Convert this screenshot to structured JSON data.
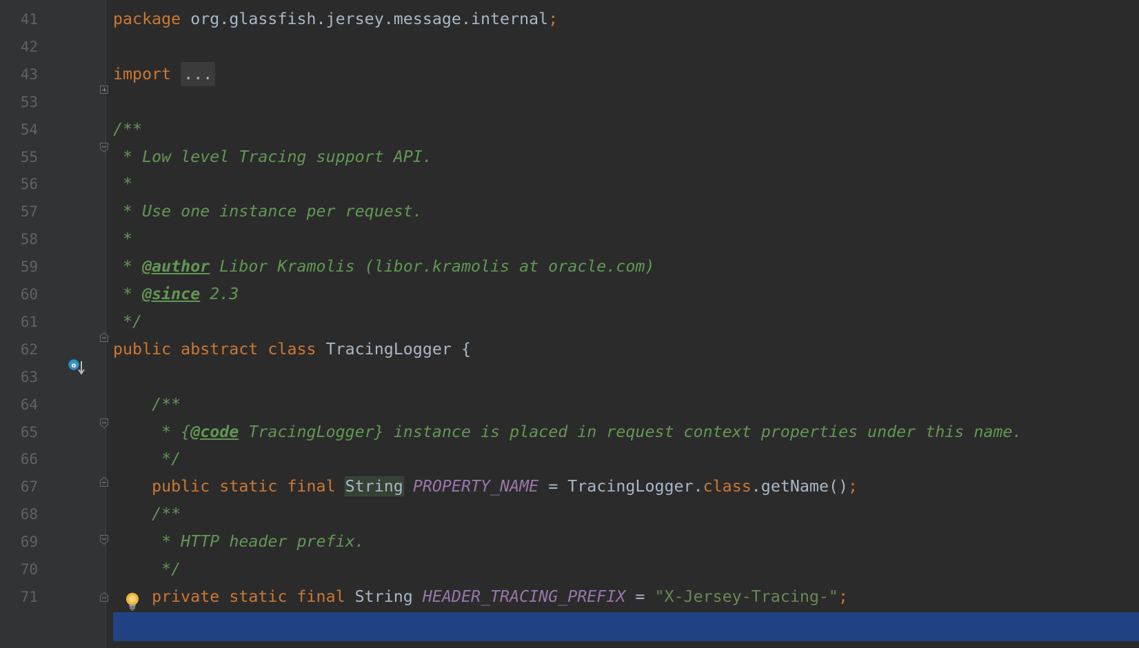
{
  "editor": {
    "lines": [
      {
        "n": "41",
        "segs": [
          [
            "kw",
            "package "
          ],
          [
            "pl",
            "org.glassfish.jersey.message.internal"
          ],
          [
            "kw",
            ";"
          ]
        ]
      },
      {
        "n": "42",
        "segs": []
      },
      {
        "n": "43",
        "segs": [
          [
            "kw",
            "import "
          ],
          [
            "fold",
            "..."
          ]
        ]
      },
      {
        "n": "53",
        "segs": []
      },
      {
        "n": "54",
        "segs": [
          [
            "cm",
            "/**"
          ]
        ]
      },
      {
        "n": "55",
        "segs": [
          [
            "cm",
            " * Low level Tracing support API."
          ]
        ]
      },
      {
        "n": "56",
        "segs": [
          [
            "cm",
            " *"
          ]
        ]
      },
      {
        "n": "57",
        "segs": [
          [
            "cm",
            " * Use one instance per request."
          ]
        ]
      },
      {
        "n": "58",
        "segs": [
          [
            "cm",
            " *"
          ]
        ]
      },
      {
        "n": "59",
        "segs": [
          [
            "cm",
            " * "
          ],
          [
            "tag",
            "@author"
          ],
          [
            "cm",
            " Libor Kramolis (libor.kramolis at oracle.com)"
          ]
        ]
      },
      {
        "n": "60",
        "segs": [
          [
            "cm",
            " * "
          ],
          [
            "tag",
            "@since"
          ],
          [
            "cm",
            " 2.3"
          ]
        ]
      },
      {
        "n": "61",
        "segs": [
          [
            "cm",
            " */"
          ]
        ]
      },
      {
        "n": "62",
        "segs": [
          [
            "kw",
            "public abstract class "
          ],
          [
            "pl",
            "TracingLogger {"
          ]
        ]
      },
      {
        "n": "63",
        "segs": []
      },
      {
        "n": "64",
        "segs": [
          [
            "pl",
            "    "
          ],
          [
            "cm",
            "/**"
          ]
        ]
      },
      {
        "n": "65",
        "segs": [
          [
            "pl",
            "    "
          ],
          [
            "cm",
            " * {"
          ],
          [
            "tag",
            "@code"
          ],
          [
            "cm",
            " TracingLogger} instance is placed in request context properties under this name."
          ]
        ]
      },
      {
        "n": "66",
        "segs": [
          [
            "pl",
            "    "
          ],
          [
            "cm",
            " */"
          ]
        ]
      },
      {
        "n": "67",
        "segs": [
          [
            "pl",
            "    "
          ],
          [
            "kw",
            "public static final "
          ],
          [
            "ref",
            "String"
          ],
          [
            "pl",
            " "
          ],
          [
            "fld",
            "PROPERTY_NAME"
          ],
          [
            "pl",
            " = TracingLogger."
          ],
          [
            "kw",
            "class"
          ],
          [
            "pl",
            ".getName()"
          ],
          [
            "kw",
            ";"
          ]
        ]
      },
      {
        "n": "68",
        "segs": [
          [
            "pl",
            "    "
          ],
          [
            "cm",
            "/**"
          ]
        ]
      },
      {
        "n": "69",
        "segs": [
          [
            "pl",
            "    "
          ],
          [
            "cm",
            " * HTTP header prefix."
          ]
        ]
      },
      {
        "n": "70",
        "segs": [
          [
            "pl",
            "    "
          ],
          [
            "cm",
            " */"
          ]
        ]
      },
      {
        "n": "71",
        "segs": [
          [
            "pl",
            "    "
          ],
          [
            "kw",
            "private static final "
          ],
          [
            "pl",
            "String "
          ],
          [
            "fld",
            "HEADER_TRACING_PREFIX"
          ],
          [
            "pl",
            " = "
          ],
          [
            "str",
            "\"X-Jersey-Tracing-\""
          ],
          [
            "kw",
            ";"
          ]
        ]
      }
    ],
    "selected_line": "71"
  },
  "gutter": {
    "override_icon": "override-method-icon",
    "bulb_icon": "intention-bulb-icon"
  },
  "colors": {
    "background": "#2b2b2b",
    "gutter": "#313335",
    "keyword": "#cc7832",
    "plain": "#a9b7c6",
    "comment": "#629755",
    "field": "#9876aa",
    "string": "#6a8759",
    "selection": "#214283",
    "line_number": "#606366"
  }
}
